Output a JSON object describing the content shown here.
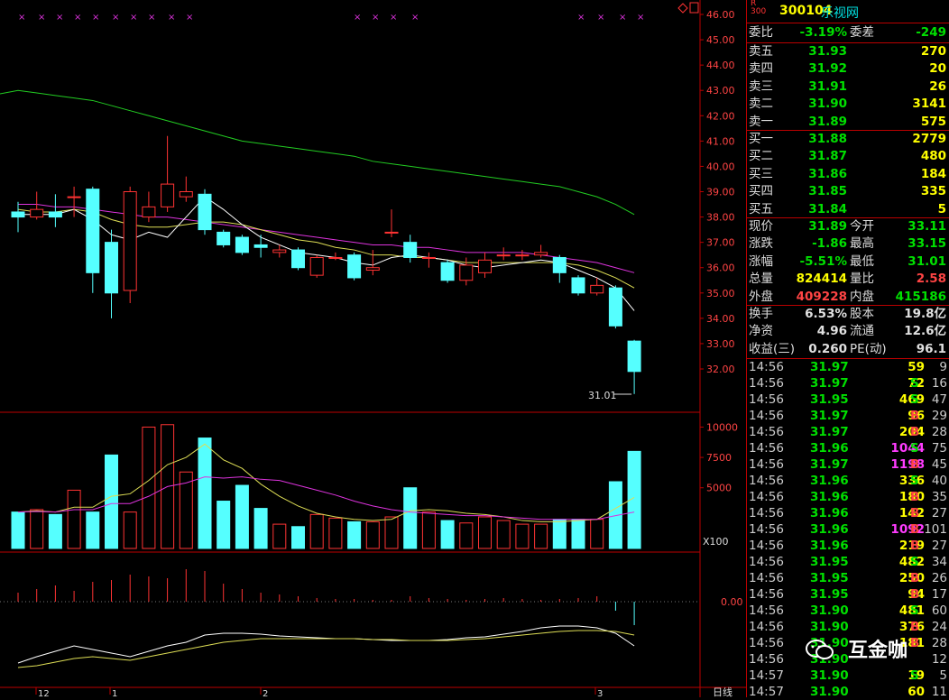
{
  "stock": {
    "prefix_top": "R",
    "prefix_bottom": "300",
    "code": "300104",
    "name": "乐视网"
  },
  "order_summary": {
    "committee_ratio_label": "委比",
    "committee_ratio": "-3.19%",
    "committee_diff_label": "委差",
    "committee_diff": "-249"
  },
  "asks": [
    {
      "label": "卖五",
      "price": "31.93",
      "volume": "270"
    },
    {
      "label": "卖四",
      "price": "31.92",
      "volume": "20"
    },
    {
      "label": "卖三",
      "price": "31.91",
      "volume": "26"
    },
    {
      "label": "卖二",
      "price": "31.90",
      "volume": "3141"
    },
    {
      "label": "卖一",
      "price": "31.89",
      "volume": "575"
    }
  ],
  "bids": [
    {
      "label": "买一",
      "price": "31.88",
      "volume": "2779"
    },
    {
      "label": "买二",
      "price": "31.87",
      "volume": "480"
    },
    {
      "label": "买三",
      "price": "31.86",
      "volume": "184"
    },
    {
      "label": "买四",
      "price": "31.85",
      "volume": "335"
    },
    {
      "label": "买五",
      "price": "31.84",
      "volume": "5"
    }
  ],
  "quote": [
    {
      "l1": "现价",
      "v1": "31.89",
      "c1": "green",
      "l2": "今开",
      "v2": "33.11",
      "c2": "green"
    },
    {
      "l1": "涨跌",
      "v1": "-1.86",
      "c1": "green",
      "l2": "最高",
      "v2": "33.15",
      "c2": "green"
    },
    {
      "l1": "涨幅",
      "v1": "-5.51%",
      "c1": "green",
      "l2": "最低",
      "v2": "31.01",
      "c2": "green"
    },
    {
      "l1": "总量",
      "v1": "824414",
      "c1": "yellow",
      "l2": "量比",
      "v2": "2.58",
      "c2": "red"
    },
    {
      "l1": "外盘",
      "v1": "409228",
      "c1": "red",
      "l2": "内盘",
      "v2": "415186",
      "c2": "green"
    }
  ],
  "fundamentals": [
    {
      "l1": "换手",
      "v1": "6.53%",
      "l2": "股本",
      "v2": "19.8亿"
    },
    {
      "l1": "净资",
      "v1": "4.96",
      "l2": "流通",
      "v2": "12.6亿"
    },
    {
      "l1": "收益(三)",
      "v1": "0.260",
      "l2": "PE(动)",
      "v2": "96.1"
    }
  ],
  "ticks": [
    {
      "time": "14:56",
      "price": "31.97",
      "vol": "59",
      "bs": "",
      "vc": "yellow",
      "cnt": "9"
    },
    {
      "time": "14:56",
      "price": "31.97",
      "vol": "72",
      "bs": "S",
      "vc": "yellow",
      "cnt": "16"
    },
    {
      "time": "14:56",
      "price": "31.95",
      "vol": "469",
      "bs": "S",
      "vc": "yellow",
      "cnt": "47"
    },
    {
      "time": "14:56",
      "price": "31.97",
      "vol": "96",
      "bs": "B",
      "vc": "yellow",
      "cnt": "29"
    },
    {
      "time": "14:56",
      "price": "31.97",
      "vol": "204",
      "bs": "B",
      "vc": "yellow",
      "cnt": "28"
    },
    {
      "time": "14:56",
      "price": "31.96",
      "vol": "1044",
      "bs": "S",
      "vc": "magenta",
      "cnt": "75"
    },
    {
      "time": "14:56",
      "price": "31.97",
      "vol": "1198",
      "bs": "B",
      "vc": "magenta",
      "cnt": "45"
    },
    {
      "time": "14:56",
      "price": "31.96",
      "vol": "336",
      "bs": "S",
      "vc": "yellow",
      "cnt": "40"
    },
    {
      "time": "14:56",
      "price": "31.96",
      "vol": "180",
      "bs": "B",
      "vc": "yellow",
      "cnt": "35"
    },
    {
      "time": "14:56",
      "price": "31.96",
      "vol": "142",
      "bs": "B",
      "vc": "yellow",
      "cnt": "27"
    },
    {
      "time": "14:56",
      "price": "31.96",
      "vol": "1092",
      "bs": "B",
      "vc": "magenta",
      "cnt": "101"
    },
    {
      "time": "14:56",
      "price": "31.96",
      "vol": "219",
      "bs": "B",
      "vc": "yellow",
      "cnt": "27"
    },
    {
      "time": "14:56",
      "price": "31.95",
      "vol": "482",
      "bs": "S",
      "vc": "yellow",
      "cnt": "34"
    },
    {
      "time": "14:56",
      "price": "31.95",
      "vol": "250",
      "bs": "B",
      "vc": "yellow",
      "cnt": "26"
    },
    {
      "time": "14:56",
      "price": "31.95",
      "vol": "94",
      "bs": "B",
      "vc": "yellow",
      "cnt": "17"
    },
    {
      "time": "14:56",
      "price": "31.90",
      "vol": "481",
      "bs": "S",
      "vc": "yellow",
      "cnt": "60"
    },
    {
      "time": "14:56",
      "price": "31.90",
      "vol": "376",
      "bs": "B",
      "vc": "yellow",
      "cnt": "24"
    },
    {
      "time": "14:56",
      "price": "31.90",
      "vol": "181",
      "bs": "B",
      "vc": "yellow",
      "cnt": "28"
    },
    {
      "time": "14:56",
      "price": "31.90",
      "vol": "",
      "bs": "",
      "vc": "yellow",
      "cnt": "12"
    },
    {
      "time": "14:57",
      "price": "31.90",
      "vol": "19",
      "bs": "S",
      "vc": "yellow",
      "cnt": "5"
    },
    {
      "time": "14:57",
      "price": "31.90",
      "vol": "60",
      "bs": "",
      "vc": "yellow",
      "cnt": "11"
    }
  ],
  "chart_labels": {
    "price_ticks": [
      "46.00",
      "45.00",
      "44.00",
      "43.00",
      "42.00",
      "41.00",
      "40.00",
      "39.00",
      "38.00",
      "37.00",
      "36.00",
      "35.00",
      "34.00",
      "33.00",
      "32.00"
    ],
    "volume_ticks": [
      "10000",
      "7500",
      "5000"
    ],
    "volume_unit": "X100",
    "indicator_tick": "0.00",
    "low_annotation": "31.01",
    "date_labels": [
      "12",
      "1",
      "2",
      "3"
    ],
    "period_label": "日线",
    "watermark": "互金咖"
  },
  "chart_data": {
    "type": "candlestick",
    "y_range": [
      31.0,
      46.3
    ],
    "candles": [
      {
        "o": 38.2,
        "c": 38.0,
        "h": 38.6,
        "l": 37.4
      },
      {
        "o": 38.0,
        "c": 38.3,
        "h": 39.0,
        "l": 37.9
      },
      {
        "o": 38.2,
        "c": 38.0,
        "h": 38.9,
        "l": 37.6
      },
      {
        "o": 38.8,
        "c": 38.8,
        "h": 39.2,
        "l": 38.0
      },
      {
        "o": 39.1,
        "c": 35.8,
        "h": 39.2,
        "l": 35.0
      },
      {
        "o": 37.0,
        "c": 35.0,
        "h": 37.5,
        "l": 34.0
      },
      {
        "o": 35.1,
        "c": 39.0,
        "h": 39.2,
        "l": 34.6
      },
      {
        "o": 38.0,
        "c": 38.4,
        "h": 39.0,
        "l": 37.8
      },
      {
        "o": 38.4,
        "c": 39.3,
        "h": 41.2,
        "l": 38.2
      },
      {
        "o": 38.8,
        "c": 39.0,
        "h": 39.6,
        "l": 38.6
      },
      {
        "o": 38.9,
        "c": 37.5,
        "h": 39.1,
        "l": 37.3
      },
      {
        "o": 37.4,
        "c": 36.9,
        "h": 37.5,
        "l": 36.8
      },
      {
        "o": 37.2,
        "c": 36.6,
        "h": 37.3,
        "l": 36.5
      },
      {
        "o": 36.9,
        "c": 36.8,
        "h": 37.3,
        "l": 36.4
      },
      {
        "o": 36.6,
        "c": 36.7,
        "h": 36.9,
        "l": 36.4
      },
      {
        "o": 36.7,
        "c": 36.0,
        "h": 36.8,
        "l": 35.9
      },
      {
        "o": 35.7,
        "c": 36.4,
        "h": 36.5,
        "l": 35.6
      },
      {
        "o": 36.4,
        "c": 36.4,
        "h": 36.6,
        "l": 36.3
      },
      {
        "o": 36.5,
        "c": 35.6,
        "h": 36.6,
        "l": 35.5
      },
      {
        "o": 35.9,
        "c": 36.0,
        "h": 36.7,
        "l": 35.7
      },
      {
        "o": 37.4,
        "c": 37.4,
        "h": 38.3,
        "l": 37.2
      },
      {
        "o": 37.0,
        "c": 36.4,
        "h": 37.3,
        "l": 36.2
      },
      {
        "o": 36.4,
        "c": 36.4,
        "h": 36.6,
        "l": 36.0
      },
      {
        "o": 36.2,
        "c": 35.5,
        "h": 36.3,
        "l": 35.4
      },
      {
        "o": 35.5,
        "c": 36.1,
        "h": 36.4,
        "l": 35.3
      },
      {
        "o": 35.8,
        "c": 36.3,
        "h": 36.6,
        "l": 35.6
      },
      {
        "o": 36.5,
        "c": 36.5,
        "h": 36.8,
        "l": 36.3
      },
      {
        "o": 36.5,
        "c": 36.5,
        "h": 36.7,
        "l": 36.3
      },
      {
        "o": 36.5,
        "c": 36.6,
        "h": 36.9,
        "l": 36.4
      },
      {
        "o": 36.4,
        "c": 35.8,
        "h": 36.5,
        "l": 35.4
      },
      {
        "o": 35.6,
        "c": 35.0,
        "h": 35.7,
        "l": 34.9
      },
      {
        "o": 35.0,
        "c": 35.3,
        "h": 35.6,
        "l": 34.9
      },
      {
        "o": 35.2,
        "c": 33.7,
        "h": 35.3,
        "l": 33.6
      },
      {
        "o": 33.1,
        "c": 31.9,
        "h": 33.15,
        "l": 31.01
      }
    ],
    "ma_short": [
      38.1,
      38.1,
      38.1,
      38.3,
      37.9,
      37.3,
      37.1,
      37.4,
      37.2,
      38.0,
      38.8,
      38.3,
      37.7,
      37.2,
      36.9,
      36.6,
      36.5,
      36.4,
      36.2,
      36.1,
      36.4,
      36.5,
      36.4,
      36.3,
      36.1,
      36.0,
      36.1,
      36.2,
      36.3,
      36.2,
      35.9,
      35.6,
      35.2,
      34.3
    ],
    "ma_mid": [
      38.3,
      38.2,
      38.2,
      38.3,
      38.2,
      37.9,
      37.7,
      37.6,
      37.6,
      37.7,
      37.8,
      37.8,
      37.7,
      37.5,
      37.3,
      37.1,
      37.0,
      36.8,
      36.7,
      36.5,
      36.5,
      36.4,
      36.4,
      36.3,
      36.2,
      36.2,
      36.2,
      36.2,
      36.2,
      36.2,
      36.1,
      35.9,
      35.6,
      35.2
    ],
    "ma_long": [
      38.5,
      38.5,
      38.4,
      38.4,
      38.3,
      38.2,
      38.1,
      38.0,
      38.0,
      37.9,
      37.8,
      37.7,
      37.6,
      37.5,
      37.4,
      37.3,
      37.2,
      37.1,
      37.0,
      36.9,
      36.9,
      36.8,
      36.8,
      36.7,
      36.6,
      36.6,
      36.6,
      36.6,
      36.5,
      36.4,
      36.3,
      36.2,
      36.0,
      35.8
    ],
    "ma_very_long": [
      43.0,
      42.9,
      42.8,
      42.7,
      42.6,
      42.4,
      42.2,
      42.0,
      41.8,
      41.6,
      41.4,
      41.2,
      41.0,
      40.9,
      40.8,
      40.7,
      40.6,
      40.5,
      40.4,
      40.2,
      40.1,
      40.0,
      39.9,
      39.8,
      39.7,
      39.6,
      39.5,
      39.4,
      39.3,
      39.2,
      39.0,
      38.8,
      38.5,
      38.1
    ],
    "volume_range": [
      0,
      11000
    ],
    "volumes": [
      3000,
      3200,
      2800,
      4800,
      3000,
      7700,
      3000,
      10000,
      10200,
      6300,
      9100,
      3900,
      5200,
      3300,
      2000,
      1800,
      2800,
      2500,
      2200,
      2200,
      2600,
      5000,
      3000,
      2300,
      2100,
      2600,
      2300,
      2000,
      2000,
      2400,
      2400,
      2400,
      5500,
      8000
    ],
    "vol_ma_short": [
      3000,
      3100,
      3000,
      3400,
      3400,
      4300,
      4500,
      5600,
      6900,
      7500,
      8600,
      7300,
      6600,
      5300,
      4300,
      3500,
      2900,
      2600,
      2400,
      2300,
      2400,
      3100,
      3200,
      3100,
      2900,
      2800,
      2600,
      2300,
      2200,
      2200,
      2300,
      2400,
      3300,
      4200
    ],
    "vol_ma_long": [
      3000,
      3050,
      3000,
      3200,
      3200,
      3700,
      3700,
      4300,
      5100,
      5400,
      5900,
      5800,
      5900,
      5700,
      5600,
      5200,
      4800,
      4400,
      3900,
      3500,
      3200,
      3000,
      2900,
      2800,
      2700,
      2700,
      2600,
      2500,
      2400,
      2400,
      2400,
      2400,
      2700,
      3000
    ]
  }
}
